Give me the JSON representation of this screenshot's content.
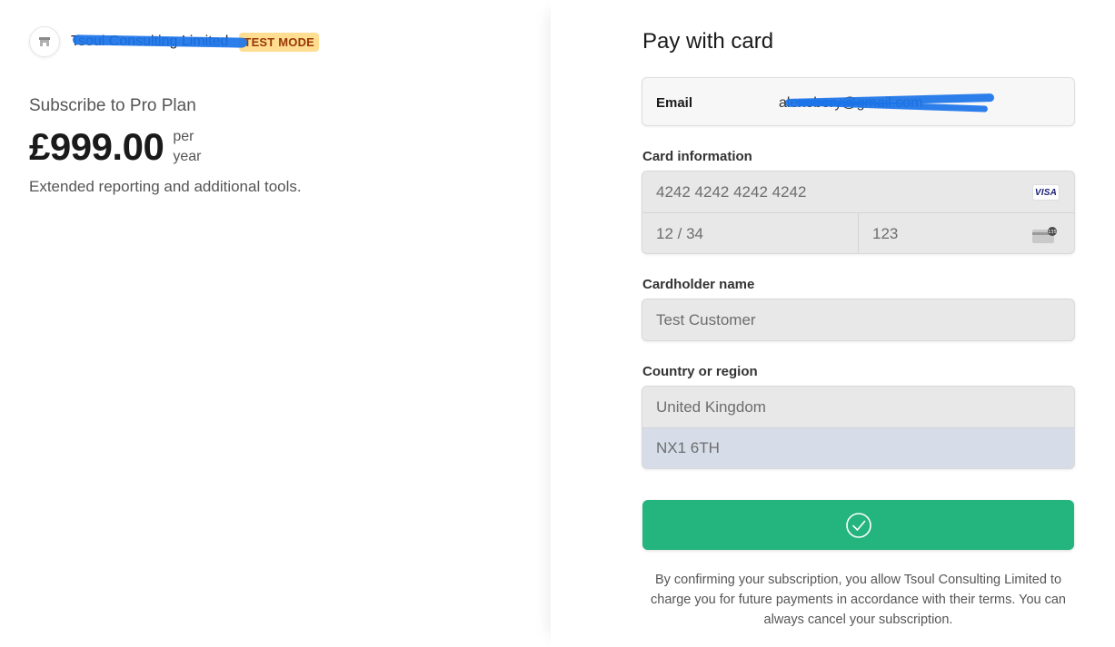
{
  "merchant": {
    "name": "Tsoul Consulting Limited",
    "test_badge": "TEST MODE",
    "logo_icon": "store-icon"
  },
  "product": {
    "subscribe_label": "Subscribe to Pro Plan",
    "price": "£999.00",
    "interval_line1": "per",
    "interval_line2": "year",
    "description": "Extended reporting and additional tools."
  },
  "form": {
    "title": "Pay with card",
    "email": {
      "label": "Email",
      "value": "alexebery@gmail.com"
    },
    "card": {
      "label": "Card information",
      "number_placeholder": "4242 4242 4242 4242",
      "expiry_placeholder": "12 / 34",
      "cvc_placeholder": "123",
      "brand_text": "VISA",
      "brand_icon": "visa-icon",
      "cvc_icon": "card-cvc-icon",
      "cvc_icon_text": "135"
    },
    "cardholder": {
      "label": "Cardholder name",
      "placeholder": "Test Customer"
    },
    "country": {
      "label": "Country or region",
      "value": "United Kingdom",
      "postal_placeholder": "NX1 6TH"
    },
    "submit": {
      "icon": "checkmark-circle-icon"
    },
    "legal_text": "By confirming your subscription, you allow Tsoul Consulting Limited to charge you for future payments in accordance with their terms. You can always cancel your subscription."
  },
  "colors": {
    "accent_green": "#24b47e",
    "test_badge_bg": "#ffde92",
    "test_badge_text": "#983705",
    "redaction": "#1a73e8"
  }
}
